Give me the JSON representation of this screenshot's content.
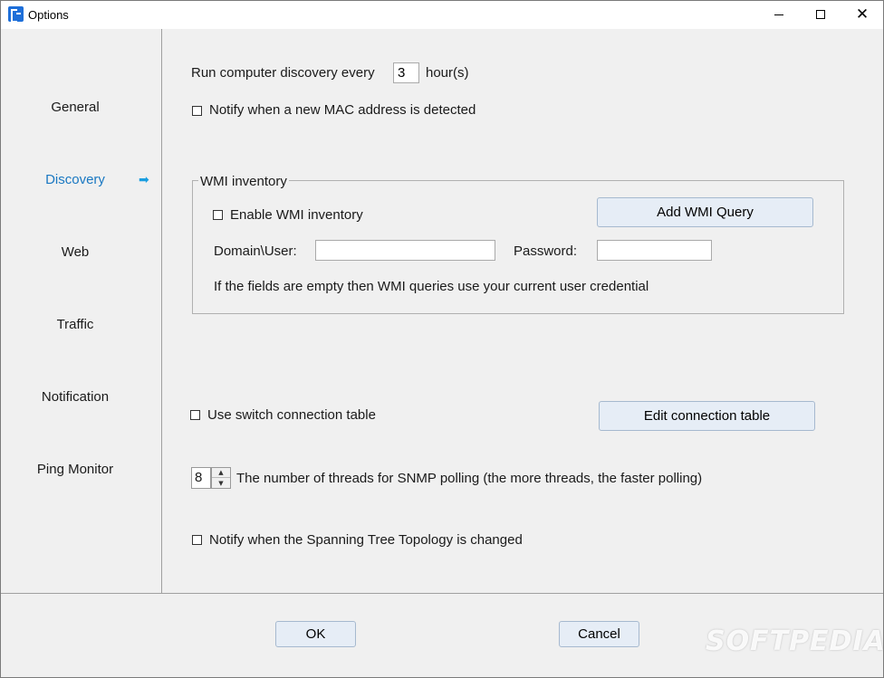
{
  "window": {
    "title": "Options"
  },
  "sidebar": {
    "items": [
      {
        "label": "General"
      },
      {
        "label": "Discovery",
        "active": true
      },
      {
        "label": "Web"
      },
      {
        "label": "Traffic"
      },
      {
        "label": "Notification"
      },
      {
        "label": "Ping Monitor"
      }
    ],
    "active_arrow": "➡"
  },
  "discovery": {
    "run_every_label": "Run computer discovery every",
    "run_every_value": "3",
    "run_every_unit": "hour(s)",
    "notify_mac_label": "Notify when a new MAC address is detected",
    "notify_mac_checked": false,
    "wmi": {
      "legend": "WMI inventory",
      "enable_label": "Enable WMI inventory",
      "enable_checked": false,
      "add_query_button": "Add WMI Query",
      "domain_user_label": "Domain\\User:",
      "domain_user_value": "",
      "password_label": "Password:",
      "password_value": "",
      "hint": "If the fields are empty then WMI queries use your current user credential"
    },
    "switch_table_label": "Use switch connection table",
    "switch_table_checked": false,
    "edit_table_button": "Edit connection table",
    "threads_value": "8",
    "threads_label": "The number of threads for SNMP polling (the more threads, the faster polling)",
    "notify_stp_label": "Notify when the Spanning Tree Topology is changed",
    "notify_stp_checked": false
  },
  "footer": {
    "ok_label": "OK",
    "cancel_label": "Cancel"
  },
  "watermark": "SOFTPEDIA",
  "colors": {
    "active_nav": "#1a78c2",
    "arrow": "#1a9ee0",
    "button_bg": "#e6edf6"
  }
}
